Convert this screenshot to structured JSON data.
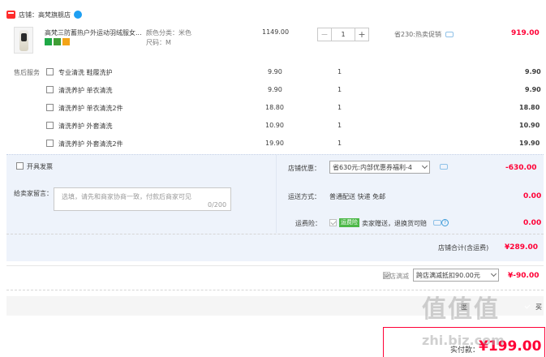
{
  "shop": {
    "label": "店铺：高梵旗舰店"
  },
  "item": {
    "title": "高梵三防蓄热户外运动羽绒服女...",
    "spec_color": "颜色分类：米色",
    "spec_size": "尺码：M",
    "unit_price": "1149.00",
    "quantity": "1",
    "promo": "省230:热卖促销",
    "total": "919.00"
  },
  "service": {
    "label": "售后服务",
    "rows": [
      {
        "name": "专业清洗 鞋履洗护",
        "price": "9.90",
        "qty": "1",
        "total": "9.90"
      },
      {
        "name": "清洗养护 单衣清洗",
        "price": "9.90",
        "qty": "1",
        "total": "9.90"
      },
      {
        "name": "清洗养护 单衣清洗2件",
        "price": "18.80",
        "qty": "1",
        "total": "18.80"
      },
      {
        "name": "清洗养护 外套清洗",
        "price": "10.90",
        "qty": "1",
        "total": "10.90"
      },
      {
        "name": "清洗养护 外套清洗2件",
        "price": "19.90",
        "qty": "1",
        "total": "19.90"
      }
    ]
  },
  "invoice": {
    "label": "开具发票"
  },
  "shop_coupon": {
    "label": "店铺优惠：",
    "value": "省630元:内部优惠券福利-4",
    "amount": "-630.00"
  },
  "message": {
    "label": "给卖家留言：",
    "placeholder": "选填，请先和商家协商一致，付款后商家可见",
    "counter": "0/200"
  },
  "shipping": {
    "label": "运送方式：",
    "value": "普通配送 快递 免邮",
    "amount": "0.00"
  },
  "insurance": {
    "label": "运费险：",
    "tag": "运费险",
    "text": "卖家赠送，退换货可赔",
    "amount": "0.00"
  },
  "shop_total": {
    "label": "店铺合计(含运费)",
    "value": "¥289.00"
  },
  "cross_store": {
    "label": "跨店满减",
    "select": "跨店满减抵扣90.00元",
    "amount": "¥-90.00"
  },
  "footer": {
    "anon_partial": "匿",
    "buy_partial": "买"
  },
  "final": {
    "label": "实付款：",
    "value": "¥199.00"
  },
  "watermark": {
    "big": "值值值",
    "small": "zhi.biz.com"
  },
  "colors": {
    "accent": "#ff0036",
    "panel": "#eef3fb",
    "link": "#3a9ad9"
  }
}
